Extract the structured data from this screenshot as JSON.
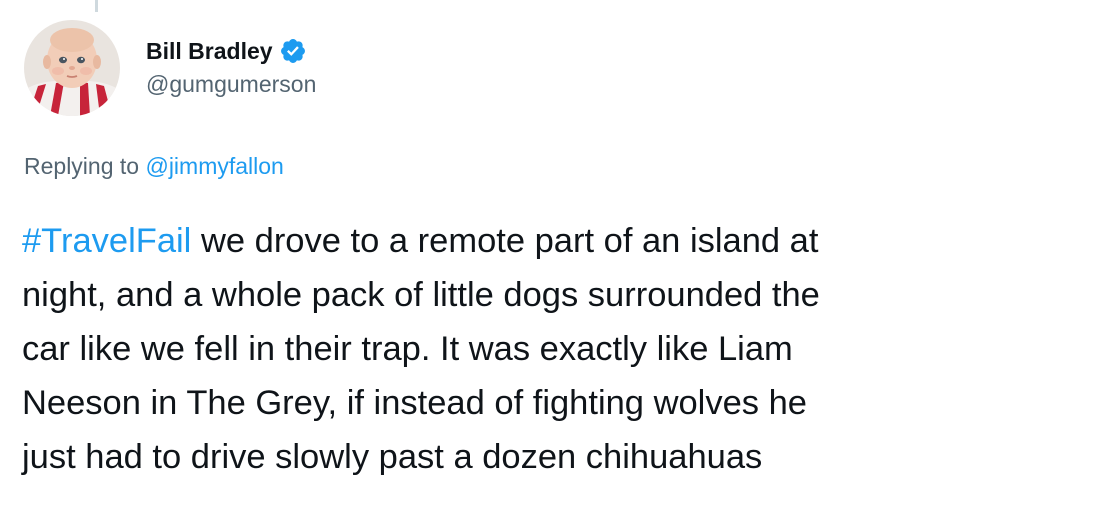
{
  "author": {
    "display_name": "Bill Bradley",
    "handle": "@gumgumerson",
    "verified": true,
    "avatar_icon": "baby-photo-avatar"
  },
  "reply": {
    "prefix": "Replying to",
    "mention": "@jimmyfallon"
  },
  "tweet": {
    "hashtag": "#TravelFail",
    "lines": [
      " we drove to a remote part of an island at",
      "night, and a whole pack of little dogs surrounded the",
      "car like we fell in their trap. It was exactly like Liam",
      "Neeson in The Grey, if instead of fighting wolves he",
      "just had to drive slowly past a dozen chihuahuas"
    ]
  },
  "colors": {
    "link": "#1d9bf0",
    "secondary_text": "#536471",
    "primary_text": "#0f1419",
    "thread_line": "#cfd9de"
  }
}
